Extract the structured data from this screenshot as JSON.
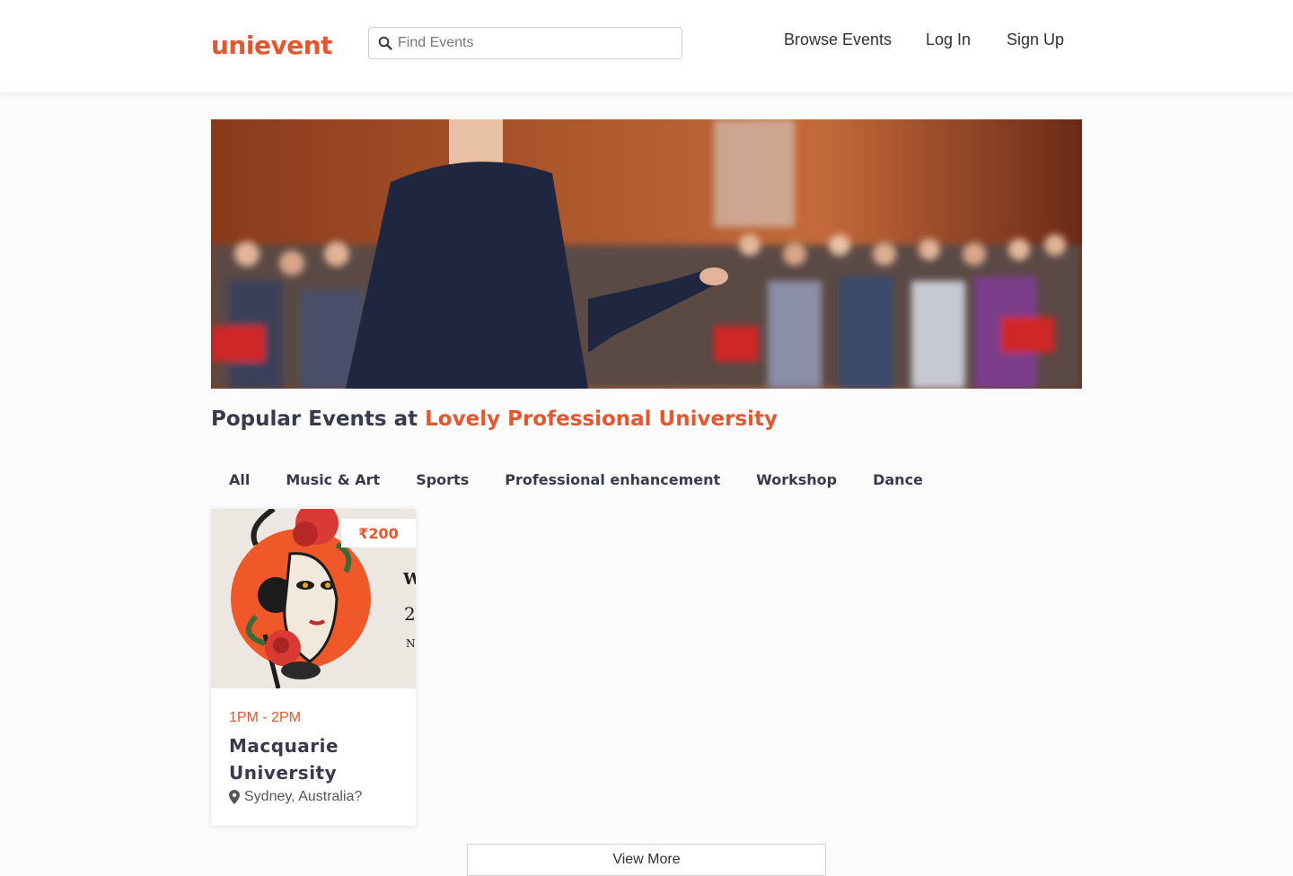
{
  "header": {
    "logo": "unievent",
    "search_placeholder": "Find Events",
    "nav": {
      "browse": "Browse Events",
      "login": "Log In",
      "signup": "Sign Up"
    }
  },
  "section": {
    "title_prefix": "Popular Events at ",
    "title_accent": "Lovely Professional University"
  },
  "tabs": [
    "All",
    "Music & Art",
    "Sports",
    "Professional enhancement",
    "Workshop",
    "Dance"
  ],
  "events": [
    {
      "price": "₹200",
      "time": "1PM - 2PM",
      "title": "Macquarie University",
      "location": "Sydney, Australia?"
    }
  ],
  "view_more": "View More",
  "colors": {
    "accent": "#e4572e",
    "text": "#3a3a4e"
  },
  "icons": {
    "search": "search-icon",
    "location": "map-marker-icon"
  }
}
